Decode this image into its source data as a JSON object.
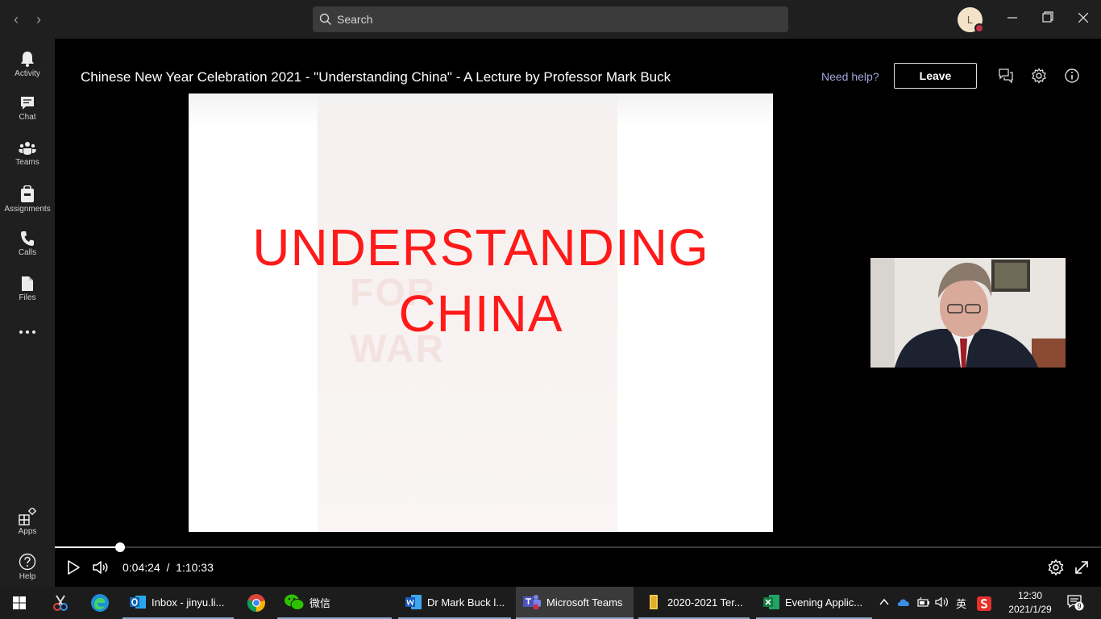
{
  "titlebar": {
    "back_icon": "chevron-left-icon",
    "forward_icon": "chevron-right-icon",
    "search_placeholder": "Search",
    "avatar_initial": "L",
    "presence_color": "#c4314b",
    "minimize_icon": "minimize-icon",
    "restore_icon": "restore-icon",
    "close_icon": "close-icon"
  },
  "rail": {
    "items": [
      {
        "label": "Activity",
        "icon": "bell-icon"
      },
      {
        "label": "Chat",
        "icon": "chat-icon"
      },
      {
        "label": "Teams",
        "icon": "teams-icon"
      },
      {
        "label": "Assignments",
        "icon": "assignments-icon"
      },
      {
        "label": "Calls",
        "icon": "phone-icon"
      },
      {
        "label": "Files",
        "icon": "file-icon"
      },
      {
        "label": "",
        "icon": "more-icon"
      }
    ],
    "bottom": [
      {
        "label": "Apps",
        "icon": "apps-icon"
      },
      {
        "label": "Help",
        "icon": "help-icon"
      }
    ]
  },
  "meeting": {
    "title": "Chinese New Year Celebration 2021 - \"Understanding China\" - A Lecture by Professor Mark Buck",
    "help_link": "Need help?",
    "leave_label": "Leave",
    "header_icons": [
      "chat-bubbles-icon",
      "settings-icon",
      "info-icon"
    ]
  },
  "slide": {
    "line1": "UNDERSTANDING",
    "line2": "CHINA",
    "text_color": "#ff1a1a"
  },
  "player": {
    "current_time": "0:04:24",
    "separator": "/",
    "total_time": "1:10:33",
    "progress_fraction": 0.0624,
    "play_icon": "play-icon",
    "volume_icon": "volume-icon",
    "settings_icon": "settings-icon",
    "fullscreen_icon": "fullscreen-icon"
  },
  "taskbar": {
    "apps": [
      {
        "label": "Inbox - jinyu.li...",
        "icon": "outlook-icon"
      },
      {
        "label": "微信",
        "icon": "wechat-icon"
      },
      {
        "label": "Dr Mark Buck l...",
        "icon": "word-icon"
      },
      {
        "label": "Microsoft Teams",
        "icon": "teams-icon"
      },
      {
        "label": "2020-2021 Ter...",
        "icon": "folder-icon"
      },
      {
        "label": "Evening Applic...",
        "icon": "excel-icon"
      }
    ],
    "tray": {
      "ime": "英",
      "time": "12:30",
      "date": "2021/1/29",
      "notification_count": "9"
    }
  }
}
